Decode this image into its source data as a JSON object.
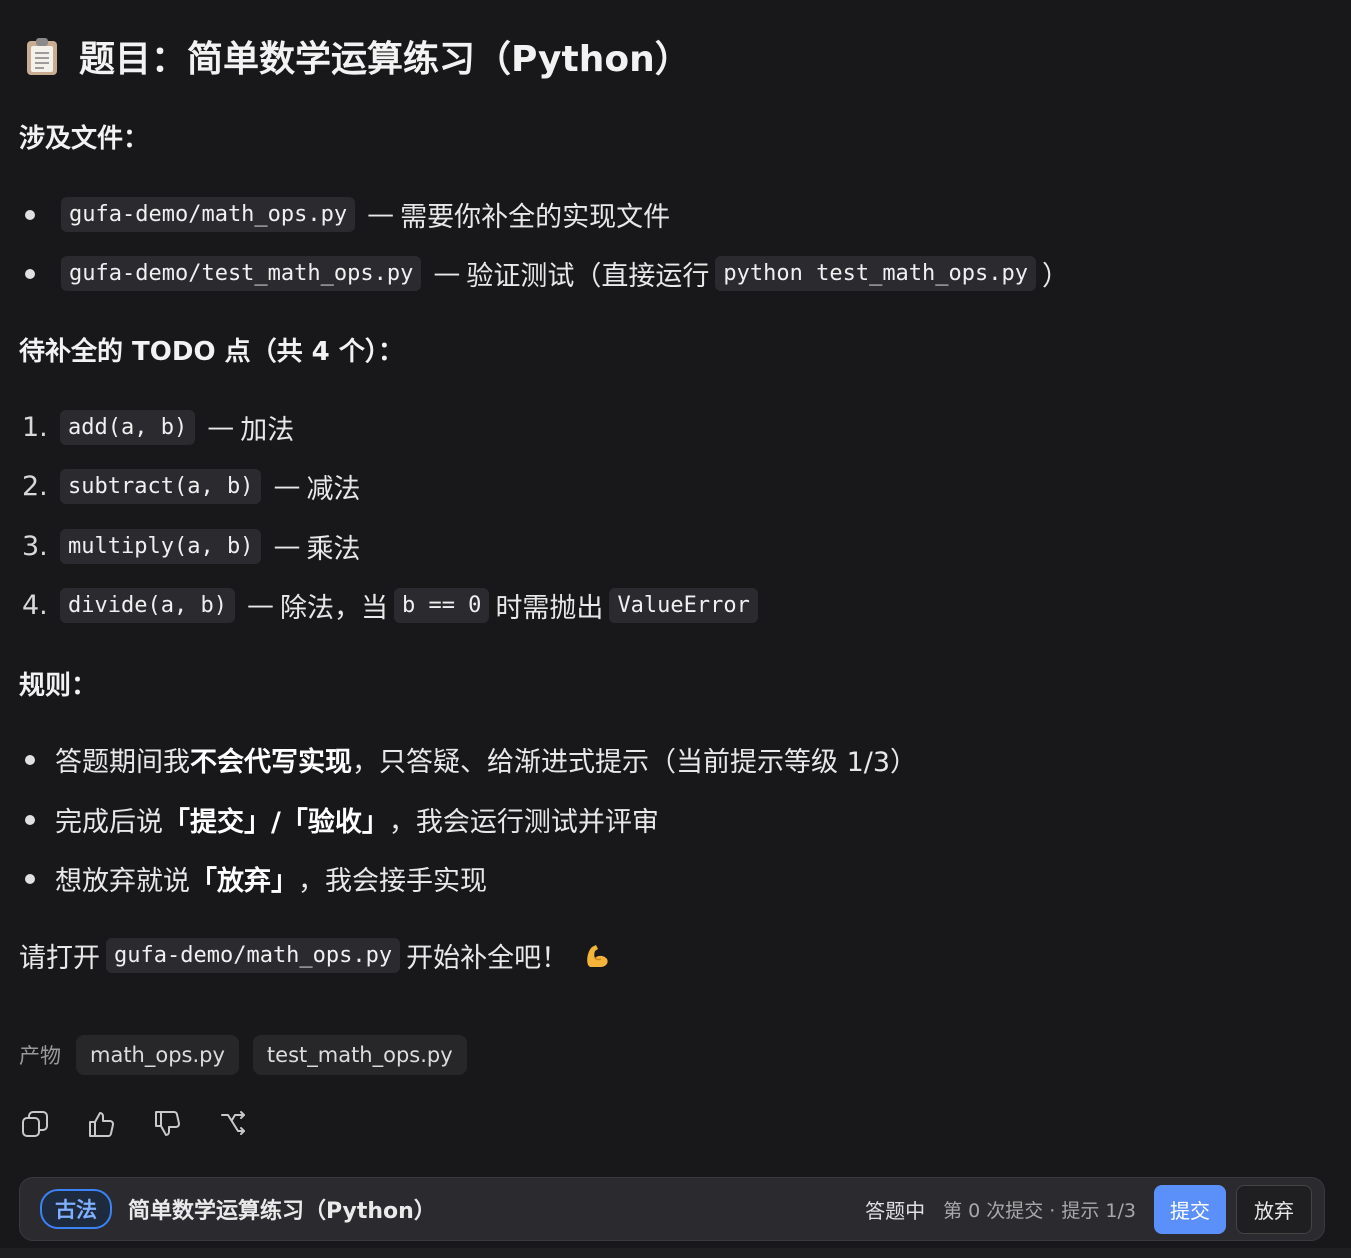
{
  "title": "题目：简单数学运算练习（Python）",
  "files_heading": "涉及文件：",
  "files": [
    {
      "code": "gufa-demo/math_ops.py",
      "sep": "—",
      "desc": "需要你补全的实现文件"
    },
    {
      "code": "gufa-demo/test_math_ops.py",
      "sep": "—",
      "desc": "验证测试（直接运行",
      "code2": "python test_math_ops.py",
      "tail": "）"
    }
  ],
  "todo_heading": "待补全的 TODO 点（共 4 个）：",
  "todos": [
    {
      "num": "1.",
      "code": "add(a, b)",
      "sep": "—",
      "desc": "加法"
    },
    {
      "num": "2.",
      "code": "subtract(a, b)",
      "sep": "—",
      "desc": "减法"
    },
    {
      "num": "3.",
      "code": "multiply(a, b)",
      "sep": "—",
      "desc": "乘法"
    },
    {
      "num": "4.",
      "code": "divide(a, b)",
      "sep": "—",
      "desc": "除法，当",
      "code2": "b == 0",
      "desc2": "时需抛出",
      "code3": "ValueError"
    }
  ],
  "rules_heading": "规则：",
  "rules": [
    {
      "pre": "答题期间我",
      "bold": "不会代写实现",
      "post": "，只答疑、给渐进式提示（当前提示等级 1/3）"
    },
    {
      "pre": "完成后说 ",
      "bold": "「提交」/「验收」",
      "post": "，我会运行测试并评审"
    },
    {
      "pre": "想放弃就说 ",
      "bold": "「放弃」",
      "post": "，我会接手实现"
    }
  ],
  "closing": {
    "pre": "请打开",
    "code": "gufa-demo/math_ops.py",
    "post": "开始补全吧！"
  },
  "artifacts": {
    "label": "产物",
    "items": [
      "math_ops.py",
      "test_math_ops.py"
    ]
  },
  "footer": {
    "tag": "古法",
    "title": "简单数学运算练习（Python）",
    "status": "答题中",
    "meta": "第 0 次提交 · 提示 1/3",
    "submit": "提交",
    "abandon": "放弃"
  },
  "icons": [
    "clipboard-icon",
    "flexed-biceps-icon",
    "copy-icon",
    "thumbs-up-icon",
    "thumbs-down-icon",
    "branch-icon"
  ],
  "colors": {
    "background": "#18181b",
    "accent": "#5b8ff9",
    "tag_border": "#3b82f6"
  }
}
